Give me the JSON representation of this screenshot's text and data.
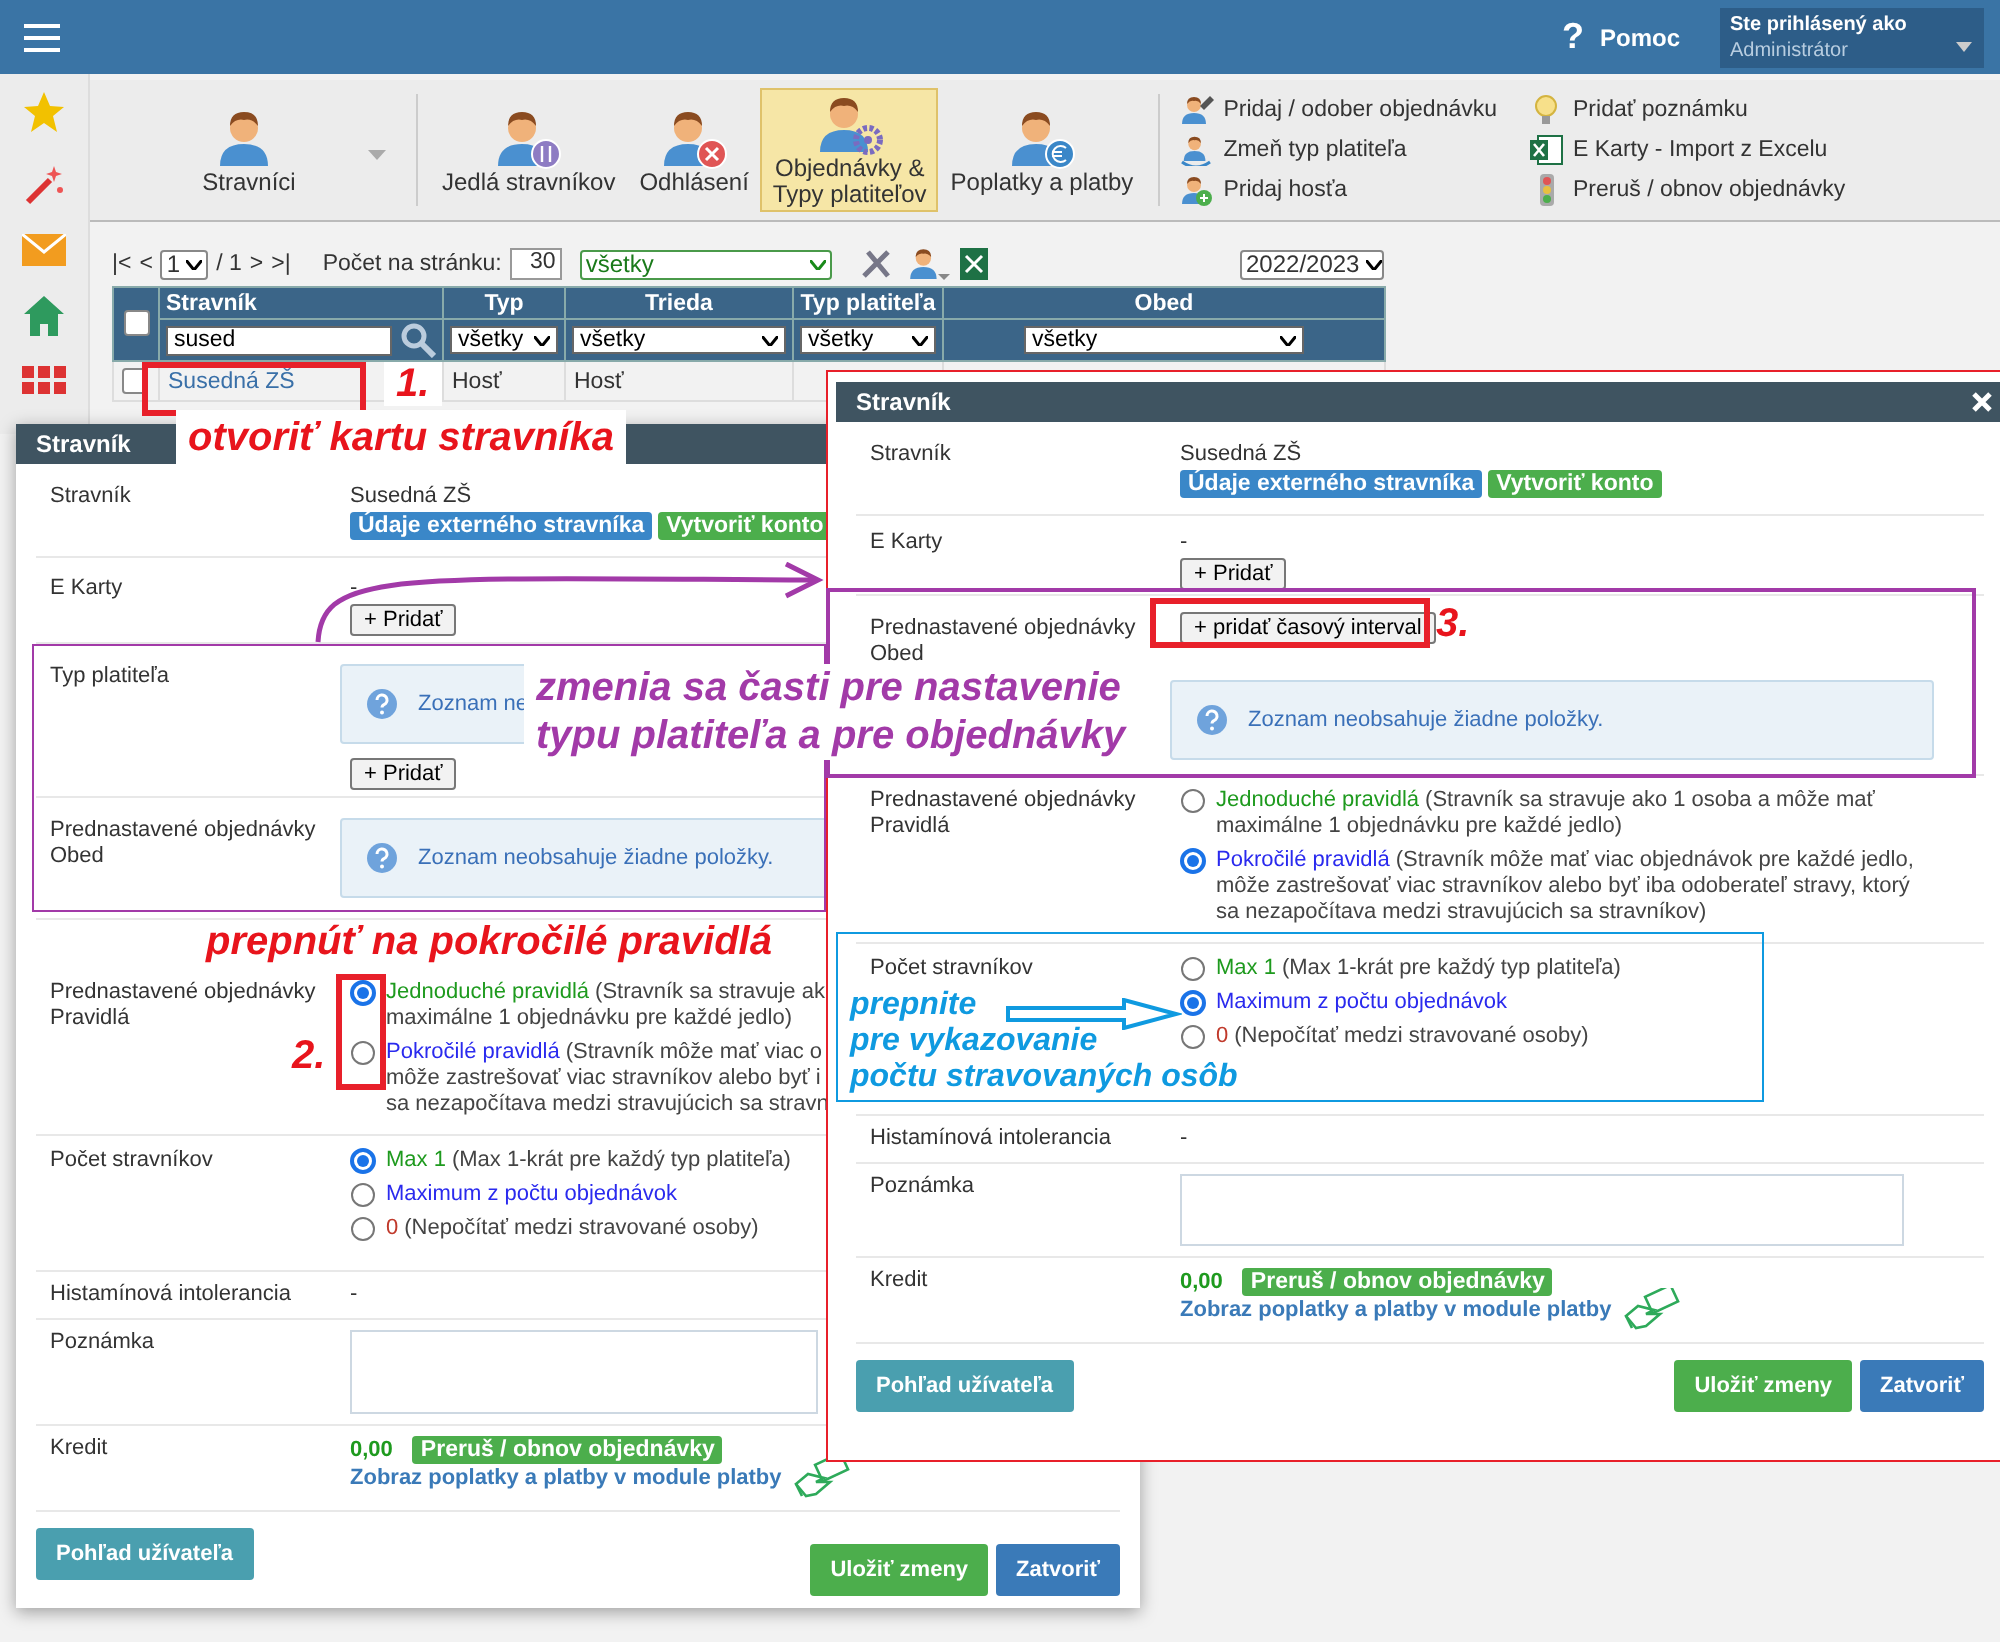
{
  "header": {
    "help_icon": "?",
    "help": "Pomoc",
    "user_label": "Ste prihlásený ako",
    "user": "Administrátor"
  },
  "toolbar": {
    "main": [
      {
        "label": "Stravníci",
        "kind": "plain",
        "selected": false,
        "dropdown": true
      },
      {
        "label": "Jedlá stravníkov",
        "kind": "fork",
        "selected": false
      },
      {
        "label": "Odhlásení",
        "kind": "cross",
        "selected": false
      },
      {
        "label": "Objednávky & Typy platiteľov",
        "kind": "gear",
        "selected": true
      },
      {
        "label": "Poplatky a platby",
        "kind": "euro",
        "selected": false
      }
    ],
    "actions": [
      {
        "label": "Pridaj / odober objednávku",
        "kind": "person-edit"
      },
      {
        "label": "Zmeň typ platiteľa",
        "kind": "person-cycle"
      },
      {
        "label": "Pridaj hosťa",
        "kind": "person-plus"
      },
      {
        "label": "Pridať poznámku",
        "kind": "bulb"
      },
      {
        "label": "E Karty - Import z Excelu",
        "kind": "sheet"
      },
      {
        "label": "Preruš / obnov objednávky",
        "kind": "signal"
      }
    ]
  },
  "grid": {
    "pager_first": "|<",
    "pager_prev": "<",
    "page": "1",
    "page_of": "/ 1",
    "pager_next": ">",
    "pager_last": ">|",
    "per_page_label": "Počet na stránku:",
    "per_page": "30",
    "filter": "všetky",
    "year": "2022/2023",
    "all_checked": false,
    "columns": [
      "Stravník",
      "Typ",
      "Trieda",
      "Typ platiteľa",
      "Obed"
    ],
    "filters": [
      {
        "kind": "search",
        "value": "sused"
      },
      {
        "kind": "select",
        "value": "všetky"
      },
      {
        "kind": "select",
        "value": "všetky"
      },
      {
        "kind": "select",
        "value": "všetky"
      },
      {
        "kind": "select",
        "value": "všetky"
      }
    ],
    "rows": [
      {
        "checked": false,
        "cells": [
          "Susedná ZŠ",
          "Hosť",
          "Hosť"
        ]
      }
    ]
  },
  "dialogs": [
    {
      "title": "Stravník",
      "rows": [
        {
          "kind": "text",
          "label": "Stravník",
          "value": "Susedná ZŠ",
          "badges": [
            {
              "text": "Údaje externého stravníka",
              "color": "#3a87c8"
            },
            {
              "text": "Vytvoriť konto",
              "color": "#4cae4c"
            }
          ]
        },
        {
          "kind": "add",
          "label": "E Karty",
          "value": "-",
          "button": "+ Pridať"
        },
        {
          "kind": "info",
          "label": "Typ platiteľa",
          "message": "Zoznam ne",
          "button": "+ Pridať"
        },
        {
          "kind": "info",
          "label": "Prednastavené objednávky Obed",
          "message": "Zoznam neobsahuje žiadne položky."
        },
        {
          "kind": "radios",
          "label": "Prednastavené objednávky Pravidlá",
          "options": [
            {
              "name": "Jednoduché pravidlá",
              "color": "#1e9a1e",
              "note_lines": [
                "(Stravník sa stravuje ak",
                "maximálne 1 objednávku pre každé jedlo)"
              ],
              "selected": true
            },
            {
              "name": "Pokročilé pravidlá",
              "color": "#2a2aee",
              "note_lines": [
                "(Stravník môže mať viac o",
                "môže zastrešovať viac  stravníkov alebo byť i",
                "sa nezapočítava medzi stravujúcich sa stravn"
              ],
              "selected": false
            }
          ]
        },
        {
          "kind": "radios",
          "label": "Počet stravníkov",
          "options": [
            {
              "name": "Max 1",
              "color": "#1e9a1e",
              "note_lines": [
                "(Max 1-krát pre každý typ platiteľa)"
              ],
              "selected": true
            },
            {
              "name": "Maximum z počtu objednávok",
              "color": "#2a2aee",
              "selected": false
            },
            {
              "name": "0",
              "color": "#c0392b",
              "note_lines": [
                "(Nepočítať medzi stravované osoby)"
              ],
              "selected": false
            }
          ]
        },
        {
          "kind": "text",
          "label": "Histamínová intolerancia",
          "value": "-"
        },
        {
          "kind": "textarea",
          "label": "Poznámka"
        },
        {
          "kind": "credit",
          "label": "Kredit",
          "amount": "0,00",
          "badge": "Preruš / obnov objednávky",
          "link": "Zobraz poplatky a platby v module platby"
        }
      ],
      "footer": {
        "view": "Pohľad užívateľa",
        "save": "Uložiť zmeny",
        "close": "Zatvoriť"
      }
    },
    {
      "title": "Stravník",
      "close": true,
      "rows": [
        {
          "kind": "text",
          "label": "Stravník",
          "value": "Susedná ZŠ",
          "badges": [
            {
              "text": "Údaje externého stravníka",
              "color": "#3a87c8"
            },
            {
              "text": "Vytvoriť konto",
              "color": "#4cae4c"
            }
          ]
        },
        {
          "kind": "add",
          "label": "E Karty",
          "value": "-",
          "button": "+ Pridať"
        },
        {
          "kind": "interval",
          "label": "Prednastavené objednávky Obed",
          "button": "+ pridať časový interval",
          "message": "Zoznam neobsahuje žiadne položky."
        },
        {
          "kind": "radios",
          "label": "Prednastavené objednávky Pravidlá",
          "options": [
            {
              "name": "Jednoduché pravidlá",
              "color": "#1e9a1e",
              "note_lines": [
                "(Stravník sa stravuje ako 1 osoba a môže mať",
                "maximálne 1 objednávku pre každé jedlo)"
              ],
              "selected": false
            },
            {
              "name": "Pokročilé pravidlá",
              "color": "#2a2aee",
              "note_lines": [
                "(Stravník môže mať viac objednávok pre každé jedlo,",
                "môže zastrešovať viac  stravníkov alebo byť iba odoberateľ stravy, ktorý",
                "sa nezapočítava medzi stravujúcich sa stravníkov)"
              ],
              "selected": true
            }
          ]
        },
        {
          "kind": "radios",
          "label": "Počet stravníkov",
          "options": [
            {
              "name": "Max 1",
              "color": "#1e9a1e",
              "note_lines": [
                "(Max 1-krát pre každý typ platiteľa)"
              ],
              "selected": false
            },
            {
              "name": "Maximum z počtu objednávok",
              "color": "#2a2aee",
              "selected": true
            },
            {
              "name": "0",
              "color": "#c0392b",
              "note_lines": [
                "(Nepočítať medzi stravované osoby)"
              ],
              "selected": false
            }
          ]
        },
        {
          "kind": "text",
          "label": "Histamínová intolerancia",
          "value": "-"
        },
        {
          "kind": "textarea",
          "label": "Poznámka"
        },
        {
          "kind": "credit",
          "label": "Kredit",
          "amount": "0,00",
          "badge": "Preruš / obnov objednávky",
          "link": "Zobraz poplatky a platby v module platby"
        }
      ],
      "footer": {
        "view": "Pohľad užívateľa",
        "save": "Uložiť zmeny",
        "close": "Zatvoriť"
      }
    }
  ],
  "annotations": {
    "step1": "1.",
    "open_card": "otvoriť kartu stravníka",
    "changes": [
      "zmenia sa časti pre nastavenie",
      "typu platiteľa a pre objednávky"
    ],
    "switch_advanced": "prepnúť na pokročilé pravidlá",
    "step2": "2.",
    "step3": "3.",
    "switch_count": [
      "prepnite",
      "pre vykazovanie",
      "počtu stravovaných osôb"
    ]
  }
}
